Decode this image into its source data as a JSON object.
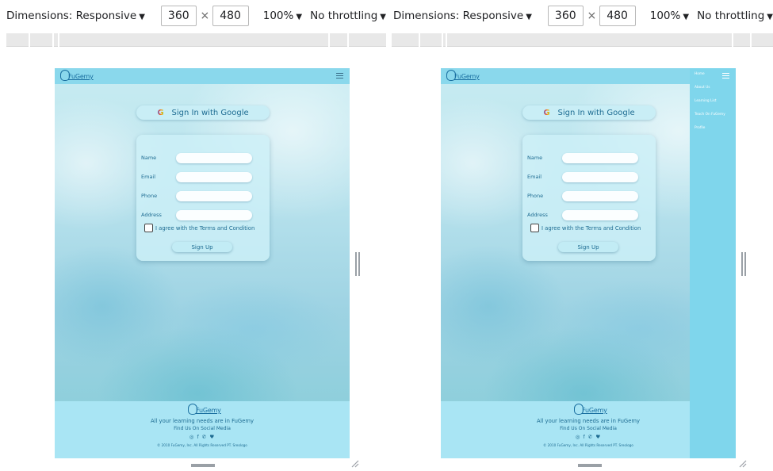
{
  "devtools": {
    "dimensions_label": "Dimensions: Responsive",
    "width_value": "360",
    "times": "×",
    "height_value": "480",
    "zoom": "100%",
    "throttling": "No throttling",
    "caret": "▼"
  },
  "site": {
    "logo_text": "FuGemy",
    "google_button": "Sign In with Google",
    "google_glyph": "G",
    "form": {
      "name_label": "Name",
      "email_label": "Email",
      "phone_label": "Phone",
      "address_label": "Address",
      "agree_text": "I agree with the Terms and Condition",
      "signup_label": "Sign Up"
    },
    "footer": {
      "tagline": "All your learning needs are in FuGemy",
      "follow": "Find Us On Social Media",
      "social_icons": "◎ f ✆ ♥",
      "copyright": "© 2010 FuGemy, Inc. All Rights Reserved PT. Sreologo"
    },
    "menu": {
      "items": [
        {
          "label": "Home"
        },
        {
          "label": "About Us"
        },
        {
          "label": "Learning List"
        },
        {
          "label": "Teach On FuGemy"
        },
        {
          "label": "Profile"
        }
      ]
    }
  },
  "colors": {
    "navbar": "#8ad8ec",
    "text": "#1e6c92",
    "footer": "#a9e5f4",
    "sidemenu": "#7fd6ec"
  }
}
